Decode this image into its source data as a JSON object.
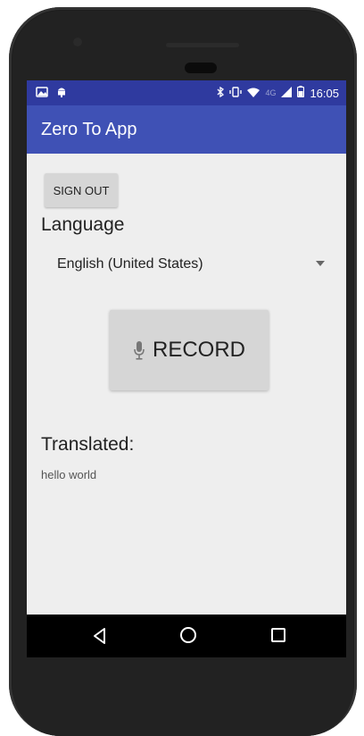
{
  "status_bar": {
    "time": "16:05",
    "network": "4G",
    "icons": [
      "photo-notification-icon",
      "android-notification-icon",
      "bluetooth-icon",
      "vibrate-icon",
      "wifi-icon",
      "signal-icon",
      "battery-icon"
    ]
  },
  "app_bar": {
    "title": "Zero To App"
  },
  "sign_out": {
    "label": "SIGN OUT"
  },
  "language": {
    "label": "Language",
    "selected": "English (United States)"
  },
  "record": {
    "label": "RECORD",
    "icon": "microphone-icon"
  },
  "translated": {
    "label": "Translated:",
    "text": "hello world"
  },
  "nav": {
    "icons": [
      "back-icon",
      "home-icon",
      "recents-icon"
    ]
  },
  "colors": {
    "app_bar": "#3f51b5",
    "status_bar": "#2f3a9f",
    "background": "#eeeeee",
    "button": "#d6d6d6",
    "phone_body": "#1d1d1d"
  }
}
